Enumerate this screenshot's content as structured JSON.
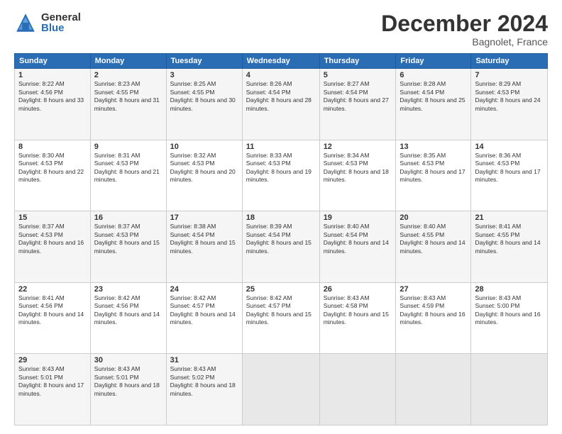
{
  "logo": {
    "general": "General",
    "blue": "Blue"
  },
  "title": "December 2024",
  "location": "Bagnolet, France",
  "days_of_week": [
    "Sunday",
    "Monday",
    "Tuesday",
    "Wednesday",
    "Thursday",
    "Friday",
    "Saturday"
  ],
  "weeks": [
    [
      {
        "day": "1",
        "sunrise": "8:22 AM",
        "sunset": "4:56 PM",
        "daylight": "8 hours and 33 minutes."
      },
      {
        "day": "2",
        "sunrise": "8:23 AM",
        "sunset": "4:55 PM",
        "daylight": "8 hours and 31 minutes."
      },
      {
        "day": "3",
        "sunrise": "8:25 AM",
        "sunset": "4:55 PM",
        "daylight": "8 hours and 30 minutes."
      },
      {
        "day": "4",
        "sunrise": "8:26 AM",
        "sunset": "4:54 PM",
        "daylight": "8 hours and 28 minutes."
      },
      {
        "day": "5",
        "sunrise": "8:27 AM",
        "sunset": "4:54 PM",
        "daylight": "8 hours and 27 minutes."
      },
      {
        "day": "6",
        "sunrise": "8:28 AM",
        "sunset": "4:54 PM",
        "daylight": "8 hours and 25 minutes."
      },
      {
        "day": "7",
        "sunrise": "8:29 AM",
        "sunset": "4:53 PM",
        "daylight": "8 hours and 24 minutes."
      }
    ],
    [
      {
        "day": "8",
        "sunrise": "8:30 AM",
        "sunset": "4:53 PM",
        "daylight": "8 hours and 22 minutes."
      },
      {
        "day": "9",
        "sunrise": "8:31 AM",
        "sunset": "4:53 PM",
        "daylight": "8 hours and 21 minutes."
      },
      {
        "day": "10",
        "sunrise": "8:32 AM",
        "sunset": "4:53 PM",
        "daylight": "8 hours and 20 minutes."
      },
      {
        "day": "11",
        "sunrise": "8:33 AM",
        "sunset": "4:53 PM",
        "daylight": "8 hours and 19 minutes."
      },
      {
        "day": "12",
        "sunrise": "8:34 AM",
        "sunset": "4:53 PM",
        "daylight": "8 hours and 18 minutes."
      },
      {
        "day": "13",
        "sunrise": "8:35 AM",
        "sunset": "4:53 PM",
        "daylight": "8 hours and 17 minutes."
      },
      {
        "day": "14",
        "sunrise": "8:36 AM",
        "sunset": "4:53 PM",
        "daylight": "8 hours and 17 minutes."
      }
    ],
    [
      {
        "day": "15",
        "sunrise": "8:37 AM",
        "sunset": "4:53 PM",
        "daylight": "8 hours and 16 minutes."
      },
      {
        "day": "16",
        "sunrise": "8:37 AM",
        "sunset": "4:53 PM",
        "daylight": "8 hours and 15 minutes."
      },
      {
        "day": "17",
        "sunrise": "8:38 AM",
        "sunset": "4:54 PM",
        "daylight": "8 hours and 15 minutes."
      },
      {
        "day": "18",
        "sunrise": "8:39 AM",
        "sunset": "4:54 PM",
        "daylight": "8 hours and 15 minutes."
      },
      {
        "day": "19",
        "sunrise": "8:40 AM",
        "sunset": "4:54 PM",
        "daylight": "8 hours and 14 minutes."
      },
      {
        "day": "20",
        "sunrise": "8:40 AM",
        "sunset": "4:55 PM",
        "daylight": "8 hours and 14 minutes."
      },
      {
        "day": "21",
        "sunrise": "8:41 AM",
        "sunset": "4:55 PM",
        "daylight": "8 hours and 14 minutes."
      }
    ],
    [
      {
        "day": "22",
        "sunrise": "8:41 AM",
        "sunset": "4:56 PM",
        "daylight": "8 hours and 14 minutes."
      },
      {
        "day": "23",
        "sunrise": "8:42 AM",
        "sunset": "4:56 PM",
        "daylight": "8 hours and 14 minutes."
      },
      {
        "day": "24",
        "sunrise": "8:42 AM",
        "sunset": "4:57 PM",
        "daylight": "8 hours and 14 minutes."
      },
      {
        "day": "25",
        "sunrise": "8:42 AM",
        "sunset": "4:57 PM",
        "daylight": "8 hours and 15 minutes."
      },
      {
        "day": "26",
        "sunrise": "8:43 AM",
        "sunset": "4:58 PM",
        "daylight": "8 hours and 15 minutes."
      },
      {
        "day": "27",
        "sunrise": "8:43 AM",
        "sunset": "4:59 PM",
        "daylight": "8 hours and 16 minutes."
      },
      {
        "day": "28",
        "sunrise": "8:43 AM",
        "sunset": "5:00 PM",
        "daylight": "8 hours and 16 minutes."
      }
    ],
    [
      {
        "day": "29",
        "sunrise": "8:43 AM",
        "sunset": "5:01 PM",
        "daylight": "8 hours and 17 minutes."
      },
      {
        "day": "30",
        "sunrise": "8:43 AM",
        "sunset": "5:01 PM",
        "daylight": "8 hours and 18 minutes."
      },
      {
        "day": "31",
        "sunrise": "8:43 AM",
        "sunset": "5:02 PM",
        "daylight": "8 hours and 18 minutes."
      },
      null,
      null,
      null,
      null
    ]
  ]
}
